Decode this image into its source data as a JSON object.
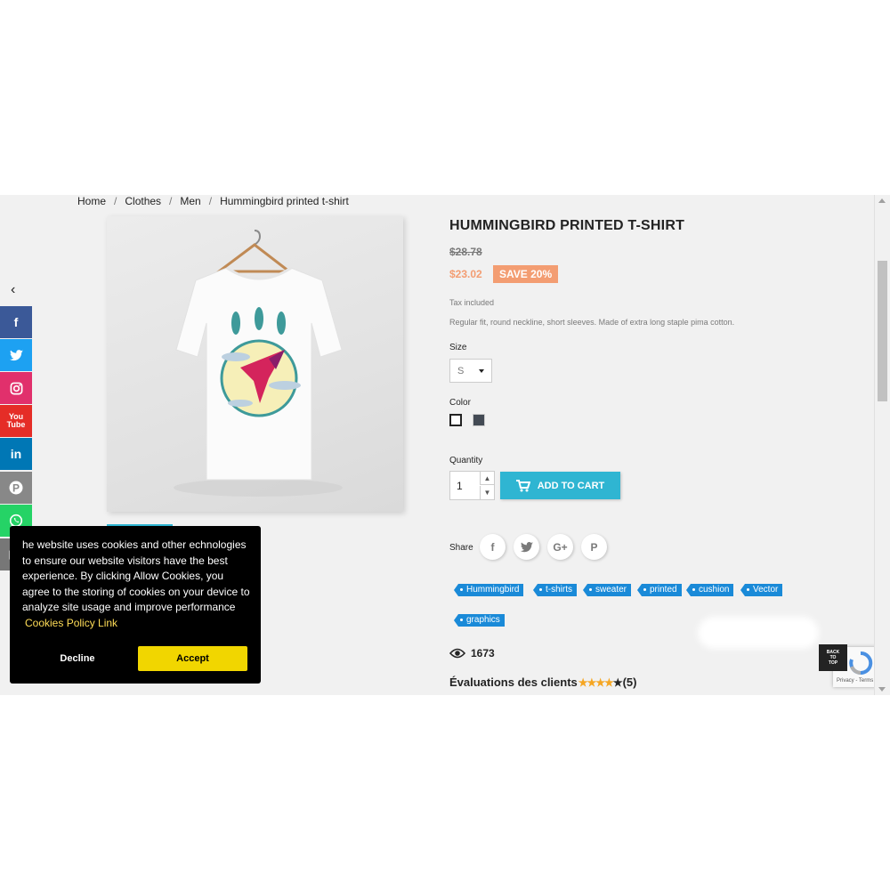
{
  "breadcrumb": [
    {
      "label": "Home"
    },
    {
      "label": "Clothes"
    },
    {
      "label": "Men"
    },
    {
      "label": "Hummingbird printed t-shirt"
    }
  ],
  "product": {
    "title": "HUMMINGBIRD PRINTED T-SHIRT",
    "regular_price": "$28.78",
    "price": "$23.02",
    "discount_badge": "SAVE 20%",
    "tax_note": "Tax included",
    "description": "Regular fit, round neckline, short sleeves. Made of extra long staple pima cotton.",
    "size_label": "Size",
    "size_value": "S",
    "color_label": "Color",
    "colors": [
      "#ffffff",
      "#434a54"
    ],
    "quantity_label": "Quantity",
    "quantity_value": "1",
    "add_to_cart": "ADD TO CART",
    "share_label": "Share",
    "tags": [
      "Hummingbird",
      "t-shirts",
      "sweater",
      "printed",
      "cushion",
      "Vector",
      "graphics"
    ],
    "views": "1673",
    "reviews_label": "Évaluations des clients",
    "review_count": "(5)",
    "rating_stars": 4,
    "rating_max": 5
  },
  "social_bar": {
    "icons": [
      "facebook-icon",
      "twitter-icon",
      "instagram-icon",
      "youtube-icon",
      "linkedin-icon",
      "pinterest-icon",
      "whatsapp-icon",
      "email-icon"
    ],
    "colors": [
      "#3b5998",
      "#1da1f2",
      "#e1306c",
      "#e52d27",
      "#0077b5",
      "#888888",
      "#25d366",
      "#777777"
    ]
  },
  "cookie_banner": {
    "text": "he website uses cookies and other echnologies to ensure our website visitors have the best experience. By clicking Allow Cookies, you agree to the storing of cookies on your device to analyze site usage and improve performance",
    "link": "Cookies Policy Link",
    "decline": "Decline",
    "accept": "Accept"
  },
  "back_to_top": [
    "BACK",
    "TO",
    "TOP"
  ],
  "recaptcha_text": "Privacy - Terms",
  "colors": {
    "accent": "#2fb5d2",
    "discount": "#f39d72",
    "tag": "#1a8ad8",
    "star": "#f5a623",
    "accept": "#f1d600"
  }
}
